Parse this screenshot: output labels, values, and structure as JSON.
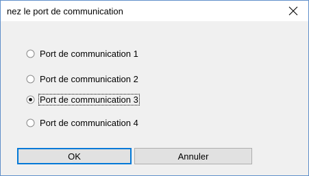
{
  "dialog": {
    "title": "nez le port de communication",
    "close_glyph": "close-icon"
  },
  "options": [
    {
      "label": "Port de communication 1",
      "checked": false
    },
    {
      "label": "Port de communication 2",
      "checked": false
    },
    {
      "label": "Port de communication 3",
      "checked": true
    },
    {
      "label": "Port de communication 4",
      "checked": false
    }
  ],
  "buttons": {
    "ok_label": "OK",
    "cancel_label": "Annuler"
  },
  "colors": {
    "window_border": "#5f8fc9",
    "default_button_border": "#0078d7"
  }
}
